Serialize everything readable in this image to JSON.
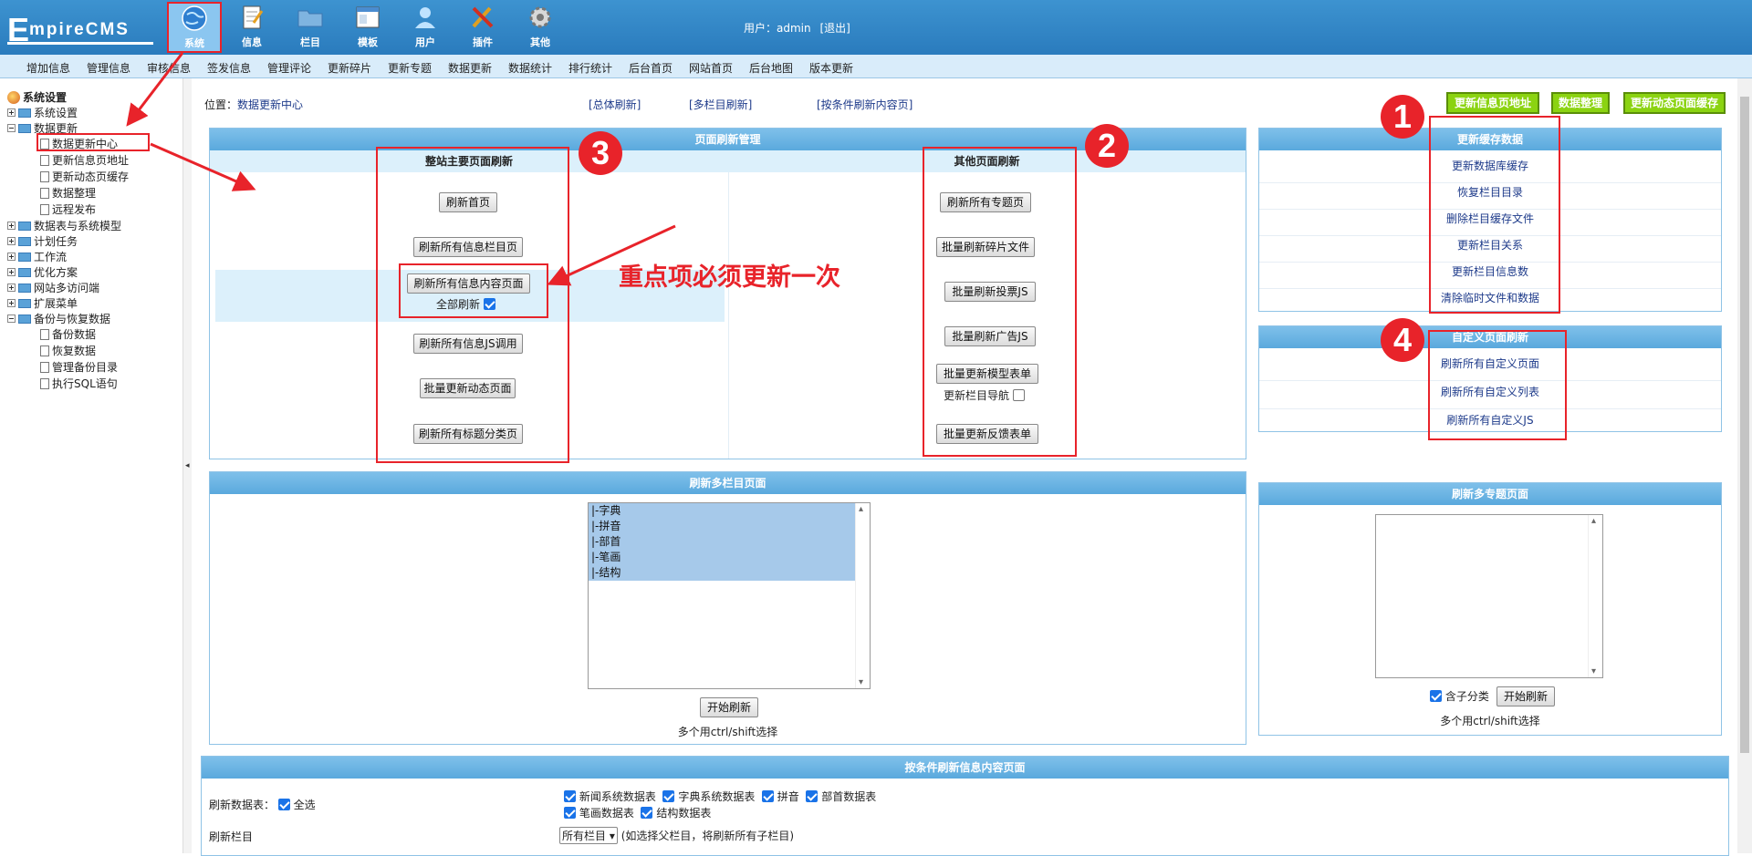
{
  "header": {
    "logo_first": "E",
    "logo_rest": "mpireCMS",
    "nav": [
      {
        "label": "系统",
        "icon": "globe-icon",
        "active": true
      },
      {
        "label": "信息",
        "icon": "document-icon"
      },
      {
        "label": "栏目",
        "icon": "folder-icon"
      },
      {
        "label": "模板",
        "icon": "template-icon"
      },
      {
        "label": "用户",
        "icon": "user-icon"
      },
      {
        "label": "插件",
        "icon": "tools-icon"
      },
      {
        "label": "其他",
        "icon": "gear-icon"
      }
    ],
    "user_prefix": "用户：",
    "user_name": "admin",
    "logout": "[退出]"
  },
  "subnav": [
    "增加信息",
    "管理信息",
    "审核信息",
    "签发信息",
    "管理评论",
    "更新碎片",
    "更新专题",
    "数据更新",
    "数据统计",
    "排行统计",
    "后台首页",
    "网站首页",
    "后台地图",
    "版本更新"
  ],
  "tree": {
    "root": "系统设置",
    "items": [
      "系统设置",
      "数据更新",
      "数据更新中心",
      "更新信息页地址",
      "更新动态页缓存",
      "数据整理",
      "远程发布",
      "数据表与系统模型",
      "计划任务",
      "工作流",
      "优化方案",
      "网站多访问端",
      "扩展菜单",
      "备份与恢复数据",
      "备份数据",
      "恢复数据",
      "管理备份目录",
      "执行SQL语句"
    ]
  },
  "location": {
    "prefix": "位置：",
    "current": "数据更新中心",
    "link1": "[总体刷新]",
    "link2": "[多栏目刷新]",
    "link3": "[按条件刷新内容页]"
  },
  "top_buttons": [
    "更新信息页地址",
    "数据整理",
    "更新动态页面缓存"
  ],
  "page_refresh": {
    "title": "页面刷新管理",
    "main_title": "整站主要页面刷新",
    "main_buttons": [
      "刷新首页",
      "刷新所有信息栏目页",
      "刷新所有信息内容页面",
      "刷新所有信息JS调用",
      "批量更新动态页面",
      "刷新所有标题分类页"
    ],
    "full_refresh_label": "全部刷新",
    "other_title": "其他页面刷新",
    "other_buttons": [
      "刷新所有专题页",
      "批量刷新碎片文件",
      "批量刷新投票JS",
      "批量刷新广告JS",
      "批量更新模型表单",
      "批量更新反馈表单"
    ],
    "nav_update_label": "更新栏目导航"
  },
  "cache": {
    "title": "更新缓存数据",
    "items": [
      "更新数据库缓存",
      "恢复栏目目录",
      "删除栏目缓存文件",
      "更新栏目关系",
      "更新栏目信息数",
      "清除临时文件和数据"
    ]
  },
  "custom": {
    "title": "自定义页面刷新",
    "items": [
      "刷新所有自定义页面",
      "刷新所有自定义列表",
      "刷新所有自定义JS"
    ]
  },
  "multi_col": {
    "title": "刷新多栏目页面",
    "options": [
      "|-字典",
      "|-拼音",
      "|-部首",
      "|-笔画",
      "|-结构"
    ],
    "start": "开始刷新",
    "hint": "多个用ctrl/shift选择"
  },
  "multi_topic": {
    "title": "刷新多专题页面",
    "include_sub": "含子分类",
    "start": "开始刷新",
    "hint": "多个用ctrl/shift选择"
  },
  "cond": {
    "title": "按条件刷新信息内容页面",
    "table_label": "刷新数据表：",
    "all_label": "全选",
    "tables": [
      "新闻系统数据表",
      "字典系统数据表",
      "拼音",
      "部首数据表",
      "笔画数据表",
      "结构数据表"
    ],
    "column_label": "刷新栏目",
    "column_select": "所有栏目",
    "column_hint": "(如选择父栏目，将刷新所有子栏目)"
  },
  "annotation": {
    "text": "重点项必须更新一次",
    "n1": "1",
    "n2": "2",
    "n3": "3",
    "n4": "4"
  },
  "colors": {
    "accent": "#2a7bbd",
    "annotation_red": "#e8232a",
    "green_button": "#8bd311"
  }
}
